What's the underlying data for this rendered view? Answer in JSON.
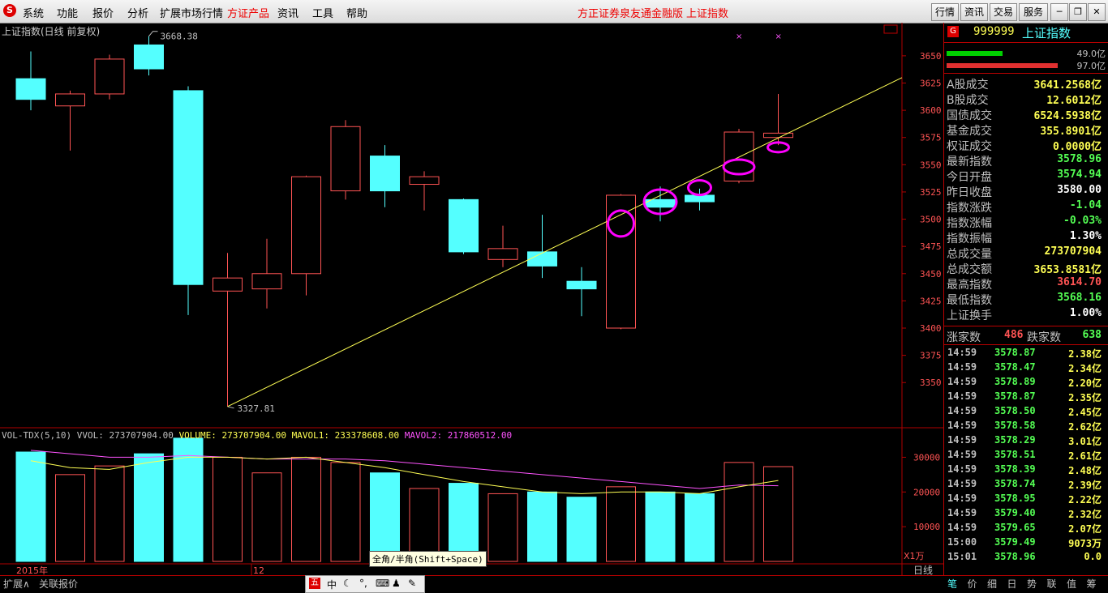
{
  "menu": {
    "items": [
      "系统",
      "功能",
      "报价",
      "分析",
      "扩展市场行情",
      "方证产品",
      "资讯",
      "工具",
      "帮助"
    ],
    "center_title": "方正证券泉友通金融版",
    "center_index": "上证指数",
    "right_buttons": [
      "行情",
      "资讯",
      "交易",
      "服务"
    ]
  },
  "chart": {
    "title": "上证指数(日线 前复权)",
    "high_label": "3668.38",
    "low_label": "3327.81",
    "year_label": "2015年",
    "month_label": "12",
    "axis_unit": "X1万",
    "period_label": "日线",
    "vol_title": {
      "name": "VOL-TDX(5,10)",
      "vvol": "VVOL: 273707904.00",
      "volume": "VOLUME: 273707904.00",
      "mavol1": "MAVOL1: 233378608.00",
      "mavol2": "MAVOL2: 217860512.00"
    }
  },
  "chart_data": {
    "type": "candlestick",
    "ylim": [
      3310,
      3670
    ],
    "yticks": [
      3350,
      3375,
      3400,
      3425,
      3450,
      3475,
      3500,
      3525,
      3550,
      3575,
      3600,
      3625,
      3650
    ],
    "candles": [
      {
        "o": 3610,
        "c": 3629,
        "h": 3654,
        "l": 3600,
        "dir": "down"
      },
      {
        "o": 3604,
        "c": 3615,
        "h": 3618,
        "l": 3563,
        "dir": "up"
      },
      {
        "o": 3615,
        "c": 3647,
        "h": 3651,
        "l": 3610,
        "dir": "up"
      },
      {
        "o": 3638,
        "c": 3660,
        "h": 3668,
        "l": 3632,
        "dir": "down"
      },
      {
        "o": 3618,
        "c": 3440,
        "h": 3622,
        "l": 3412,
        "dir": "down"
      },
      {
        "o": 3434,
        "c": 3446,
        "h": 3469,
        "l": 3328,
        "dir": "up"
      },
      {
        "o": 3436,
        "c": 3450,
        "h": 3482,
        "l": 3418,
        "dir": "up"
      },
      {
        "o": 3450,
        "c": 3539,
        "h": 3540,
        "l": 3430,
        "dir": "up"
      },
      {
        "o": 3526,
        "c": 3585,
        "h": 3591,
        "l": 3518,
        "dir": "up"
      },
      {
        "o": 3558,
        "c": 3526,
        "h": 3568,
        "l": 3511,
        "dir": "down"
      },
      {
        "o": 3532,
        "c": 3539,
        "h": 3544,
        "l": 3508,
        "dir": "up"
      },
      {
        "o": 3518,
        "c": 3470,
        "h": 3519,
        "l": 3468,
        "dir": "down"
      },
      {
        "o": 3463,
        "c": 3473,
        "h": 3494,
        "l": 3456,
        "dir": "up"
      },
      {
        "o": 3470,
        "c": 3457,
        "h": 3504,
        "l": 3446,
        "dir": "down"
      },
      {
        "o": 3443,
        "c": 3436,
        "h": 3456,
        "l": 3411,
        "dir": "down"
      },
      {
        "o": 3400,
        "c": 3522,
        "h": 3523,
        "l": 3399,
        "dir": "up"
      },
      {
        "o": 3518,
        "c": 3511,
        "h": 3530,
        "l": 3498,
        "dir": "down"
      },
      {
        "o": 3522,
        "c": 3516,
        "h": 3528,
        "l": 3508,
        "dir": "down"
      },
      {
        "o": 3535,
        "c": 3580,
        "h": 3583,
        "l": 3533,
        "dir": "up"
      },
      {
        "o": 3575,
        "c": 3579,
        "h": 3615,
        "l": 3568,
        "dir": "up"
      }
    ],
    "volume": {
      "ylim": [
        0,
        35000
      ],
      "yticks": [
        10000,
        20000,
        30000
      ],
      "values": [
        31500,
        25000,
        27500,
        31000,
        35500,
        30000,
        25500,
        30000,
        28500,
        25500,
        21000,
        22500,
        19500,
        20000,
        18500,
        21500,
        20000,
        19500,
        28500,
        27300
      ],
      "mavol1": [
        29000,
        27000,
        26500,
        28500,
        30000,
        30000,
        29500,
        30000,
        28500,
        27000,
        25000,
        23000,
        21500,
        20000,
        19500,
        20000,
        20000,
        19500,
        21500,
        23300
      ],
      "mavol2": [
        32000,
        31000,
        30000,
        30000,
        30500,
        30000,
        29500,
        29500,
        29500,
        29000,
        28000,
        27000,
        26000,
        25000,
        24000,
        23000,
        22000,
        21000,
        22000,
        21800
      ]
    },
    "trendline": {
      "from": [
        5,
        3328
      ],
      "to": [
        21,
        3630
      ]
    },
    "circled_candles": [
      15,
      16,
      17,
      18,
      19
    ]
  },
  "colors": {
    "up": "#ff5454",
    "down": "#54ffff",
    "trend": "#ffff54",
    "circle": "#ff00ff",
    "axis": "#b00000",
    "grid": "#500000"
  },
  "quote": {
    "code": "999999",
    "name": "上证指数",
    "bar_top_value": "49.0亿",
    "bar_bottom_value": "97.0亿",
    "rows": [
      {
        "label": "A股成交",
        "value": "3641.2568亿",
        "color": "#ffff54"
      },
      {
        "label": "B股成交",
        "value": "12.6012亿",
        "color": "#ffff54"
      },
      {
        "label": "国债成交",
        "value": "6524.5938亿",
        "color": "#ffff54"
      },
      {
        "label": "基金成交",
        "value": "355.8901亿",
        "color": "#ffff54"
      },
      {
        "label": "权证成交",
        "value": "0.0000亿",
        "color": "#ffff54"
      },
      {
        "label": "最新指数",
        "value": "3578.96",
        "color": "#54ff54"
      },
      {
        "label": "今日开盘",
        "value": "3574.94",
        "color": "#54ff54"
      },
      {
        "label": "昨日收盘",
        "value": "3580.00",
        "color": "#ffffff"
      },
      {
        "label": "指数涨跌",
        "value": "-1.04",
        "color": "#54ff54"
      },
      {
        "label": "指数涨幅",
        "value": "-0.03%",
        "color": "#54ff54"
      },
      {
        "label": "指数振幅",
        "value": "1.30%",
        "color": "#ffffff"
      },
      {
        "label": "总成交量",
        "value": "273707904",
        "color": "#ffff54"
      },
      {
        "label": "总成交额",
        "value": "3653.8581亿",
        "color": "#ffff54"
      },
      {
        "label": "最高指数",
        "value": "3614.70",
        "color": "#ff5454"
      },
      {
        "label": "最低指数",
        "value": "3568.16",
        "color": "#54ff54"
      },
      {
        "label": "上证换手",
        "value": "1.00%",
        "color": "#ffffff"
      }
    ],
    "up_count_label": "涨家数",
    "up_count": "486",
    "down_count_label": "跌家数",
    "down_count": "638",
    "ticks": [
      {
        "t": "14:59",
        "p": "3578.87",
        "v": "2.38亿",
        "c": "#54ff54"
      },
      {
        "t": "14:59",
        "p": "3578.47",
        "v": "2.34亿",
        "c": "#54ff54"
      },
      {
        "t": "14:59",
        "p": "3578.89",
        "v": "2.20亿",
        "c": "#54ff54"
      },
      {
        "t": "14:59",
        "p": "3578.87",
        "v": "2.35亿",
        "c": "#54ff54"
      },
      {
        "t": "14:59",
        "p": "3578.50",
        "v": "2.45亿",
        "c": "#54ff54"
      },
      {
        "t": "14:59",
        "p": "3578.58",
        "v": "2.62亿",
        "c": "#54ff54"
      },
      {
        "t": "14:59",
        "p": "3578.29",
        "v": "3.01亿",
        "c": "#54ff54"
      },
      {
        "t": "14:59",
        "p": "3578.51",
        "v": "2.61亿",
        "c": "#54ff54"
      },
      {
        "t": "14:59",
        "p": "3578.39",
        "v": "2.48亿",
        "c": "#54ff54"
      },
      {
        "t": "14:59",
        "p": "3578.74",
        "v": "2.39亿",
        "c": "#54ff54"
      },
      {
        "t": "14:59",
        "p": "3578.95",
        "v": "2.22亿",
        "c": "#54ff54"
      },
      {
        "t": "14:59",
        "p": "3579.40",
        "v": "2.32亿",
        "c": "#54ff54"
      },
      {
        "t": "14:59",
        "p": "3579.65",
        "v": "2.07亿",
        "c": "#54ff54"
      },
      {
        "t": "15:00",
        "p": "3579.49",
        "v": "9073万",
        "c": "#54ff54"
      },
      {
        "t": "15:01",
        "p": "3578.96",
        "v": "0.0",
        "c": "#54ff54"
      }
    ],
    "bottom_tabs": [
      "笔",
      "价",
      "细",
      "日",
      "势",
      "联",
      "值",
      "筹"
    ]
  },
  "status": {
    "left_tab1": "扩展∧",
    "left_tab2": "关联报价",
    "ime_tip": "全角/半角(Shift+Space)",
    "ime_mode": "中"
  }
}
